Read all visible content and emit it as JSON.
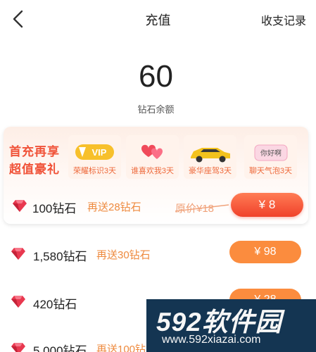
{
  "header": {
    "title": "充值",
    "records_label": "收支记录"
  },
  "balance": {
    "value": "60",
    "label": "钻石余额"
  },
  "promo": {
    "slogan_line1": "首充再享",
    "slogan_line2": "超值豪礼",
    "perks": [
      {
        "label": "荣耀标识3天",
        "badge_text": "VIP",
        "icon": "vip-badge-icon"
      },
      {
        "label": "谁喜欢我3天",
        "icon": "hearts-icon"
      },
      {
        "label": "豪华座驾3天",
        "icon": "car-icon"
      },
      {
        "label": "聊天气泡3天",
        "badge_text": "你好啊",
        "icon": "chat-bubble-icon"
      }
    ],
    "offer": {
      "amount": "100钻石",
      "bonus": "再送28钻石",
      "original_price": "原价¥18",
      "price": "¥ 8"
    }
  },
  "packages": [
    {
      "amount": "1,580钻石",
      "bonus": "再送30钻石",
      "price": "¥ 98"
    },
    {
      "amount": "420钻石",
      "bonus": "",
      "price": "¥ 28"
    },
    {
      "amount": "5,000钻石",
      "bonus": "再送100钻",
      "price": ""
    }
  ],
  "watermark": {
    "title": "592软件园",
    "url": "www.592xiazai.com"
  },
  "colors": {
    "accent_red": "#f0412a",
    "accent_orange": "#fb8c3e",
    "bonus_text": "#ee8a3e"
  }
}
